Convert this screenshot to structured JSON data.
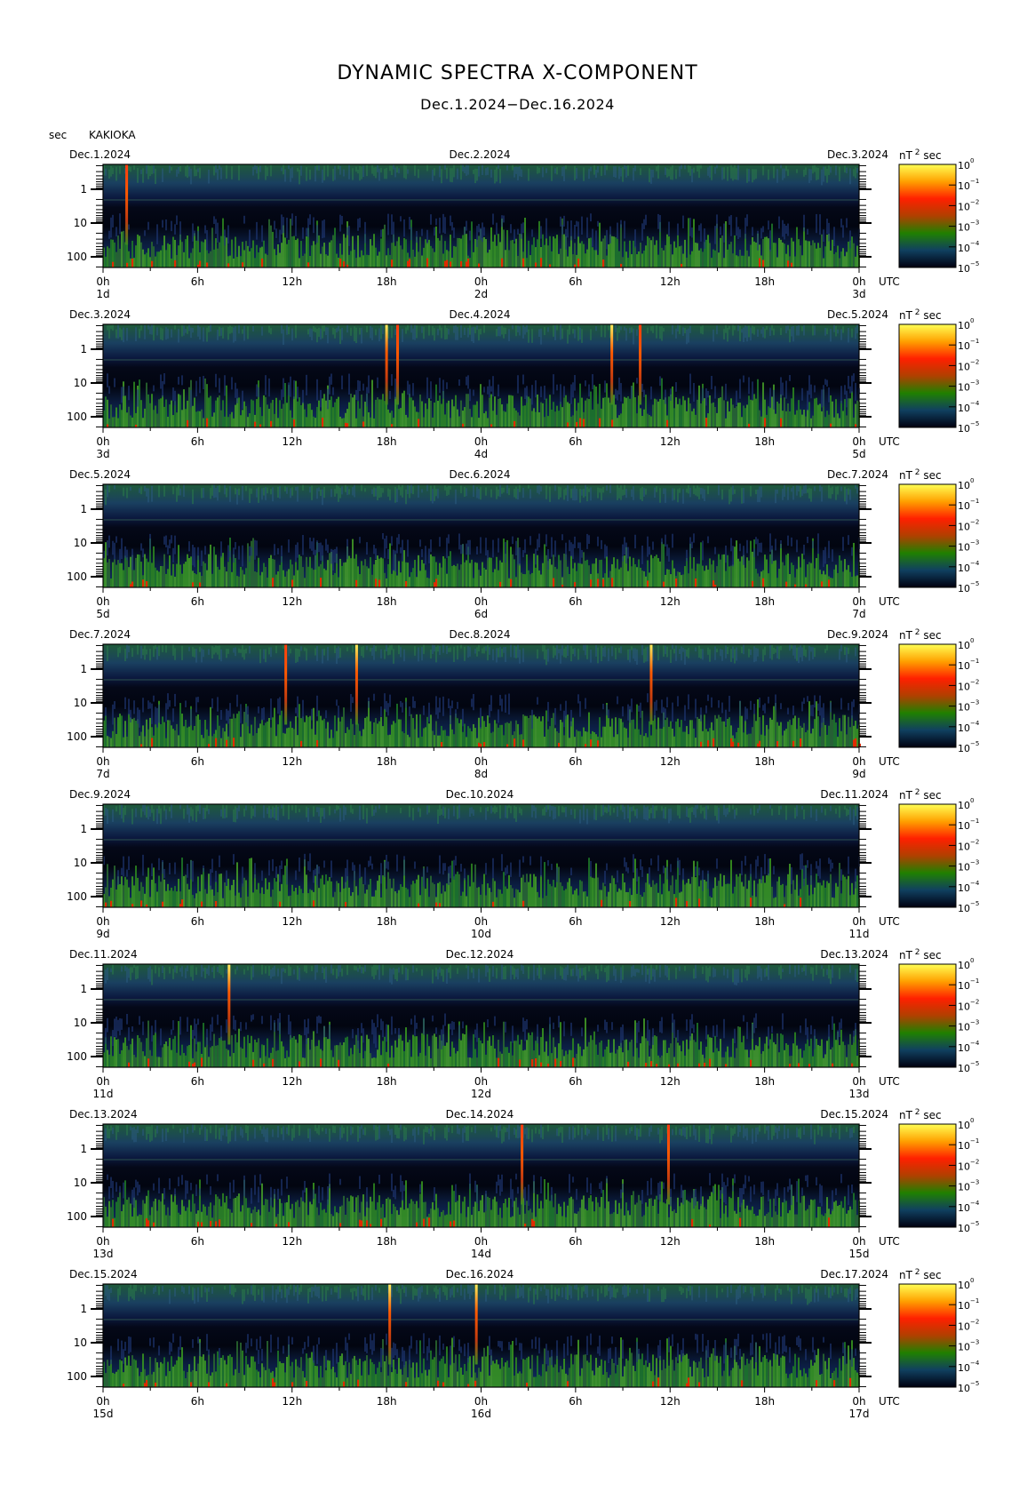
{
  "title": "DYNAMIC SPECTRA X-COMPONENT",
  "subtitle": "Dec.1.2024−Dec.16.2024",
  "unit_label": "sec",
  "station": "KAKIOKA",
  "colorbar": {
    "unit": "nT",
    "unit_exp": "2",
    "unit_suffix": "sec",
    "labels": [
      "10",
      "10",
      "10",
      "10",
      "10",
      "10"
    ],
    "exponents": [
      "0",
      "−1",
      "−2",
      "−3",
      "−4",
      "−5"
    ],
    "colors": [
      "#ffff55",
      "#ffa000",
      "#ff2000",
      "#b04000",
      "#208000",
      "#104060",
      "#000010"
    ]
  },
  "colors": {
    "background_dark": "#000008",
    "noise_blue": "#203878",
    "noise_green": "#1a7a1a",
    "event_red": "#ff2a00",
    "event_yellow": "#ffee40"
  },
  "chart_data": {
    "type": "heatmap",
    "yaxis": {
      "label": "sec",
      "ticks": [
        "1",
        "10",
        "100"
      ],
      "scale": "log"
    },
    "xaxis": {
      "ticks": [
        "0h",
        "6h",
        "12h",
        "18h",
        "0h",
        "6h",
        "12h",
        "18h",
        "0h"
      ],
      "suffix": "UTC"
    },
    "panels": [
      {
        "left_date": "Dec.1.2024",
        "mid_date": "Dec.2.2024",
        "right_date": "Dec.3.2024",
        "day_labels": [
          "1d",
          "2d",
          "3d"
        ],
        "events": [
          {
            "hour": 1.5,
            "intensity": "red"
          }
        ]
      },
      {
        "left_date": "Dec.3.2024",
        "mid_date": "Dec.4.2024",
        "right_date": "Dec.5.2024",
        "day_labels": [
          "3d",
          "4d",
          "5d"
        ],
        "events": [
          {
            "hour": 18.0,
            "intensity": "yellow"
          },
          {
            "hour": 18.7,
            "intensity": "red"
          },
          {
            "hour": 32.3,
            "intensity": "yellow"
          },
          {
            "hour": 34.1,
            "intensity": "red"
          }
        ]
      },
      {
        "left_date": "Dec.5.2024",
        "mid_date": "Dec.6.2024",
        "right_date": "Dec.7.2024",
        "day_labels": [
          "5d",
          "6d",
          "7d"
        ],
        "events": []
      },
      {
        "left_date": "Dec.7.2024",
        "mid_date": "Dec.8.2024",
        "right_date": "Dec.9.2024",
        "day_labels": [
          "7d",
          "8d",
          "9d"
        ],
        "events": [
          {
            "hour": 11.6,
            "intensity": "red"
          },
          {
            "hour": 16.1,
            "intensity": "yellow"
          },
          {
            "hour": 34.8,
            "intensity": "yellow"
          }
        ]
      },
      {
        "left_date": "Dec.9.2024",
        "mid_date": "Dec.10.2024",
        "right_date": "Dec.11.2024",
        "day_labels": [
          "9d",
          "10d",
          "11d"
        ],
        "events": []
      },
      {
        "left_date": "Dec.11.2024",
        "mid_date": "Dec.12.2024",
        "right_date": "Dec.13.2024",
        "day_labels": [
          "11d",
          "12d",
          "13d"
        ],
        "events": [
          {
            "hour": 8.0,
            "intensity": "yellow"
          }
        ]
      },
      {
        "left_date": "Dec.13.2024",
        "mid_date": "Dec.14.2024",
        "right_date": "Dec.15.2024",
        "day_labels": [
          "13d",
          "14d",
          "15d"
        ],
        "events": [
          {
            "hour": 26.6,
            "intensity": "red"
          },
          {
            "hour": 35.9,
            "intensity": "red"
          }
        ]
      },
      {
        "left_date": "Dec.15.2024",
        "mid_date": "Dec.16.2024",
        "right_date": "Dec.17.2024",
        "day_labels": [
          "15d",
          "16d",
          "17d"
        ],
        "events": [
          {
            "hour": 18.2,
            "intensity": "yellow"
          },
          {
            "hour": 23.7,
            "intensity": "yellow"
          }
        ]
      }
    ]
  }
}
